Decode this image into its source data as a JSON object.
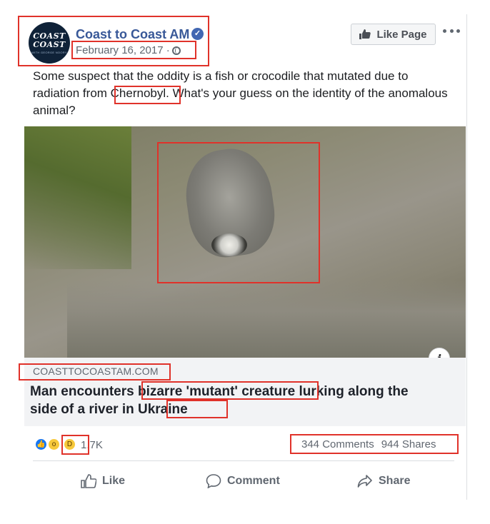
{
  "post": {
    "page_name": "Coast to Coast AM",
    "date": "February 16, 2017 ·",
    "avatar": {
      "line1": "COAST",
      "line2": "COAST",
      "line3": "WITH GEORGE NOORY"
    },
    "like_page_label": "Like Page",
    "text": "Some suspect that the oddity is a fish or crocodile that mutated due to radiation from Chernobyl. What's your guess on the identity of the anomalous animal?"
  },
  "link": {
    "domain": "COASTTOCOASTAM.COM",
    "title": "Man encounters bizarre 'mutant' creature lurking along the side of a river in Ukraine"
  },
  "stats": {
    "reactions_count": "1.7K",
    "comments": "344 Comments",
    "shares": "944 Shares"
  },
  "actions": {
    "like": "Like",
    "comment": "Comment",
    "share": "Share"
  },
  "colors": {
    "link_blue": "#385898",
    "highlight_red": "#e0322a",
    "verified_blue": "#4267b2"
  },
  "icons": [
    "verified-badge-icon",
    "globe-icon",
    "thumbs-up-icon",
    "more-options-icon",
    "info-icon",
    "comment-icon",
    "share-icon"
  ]
}
